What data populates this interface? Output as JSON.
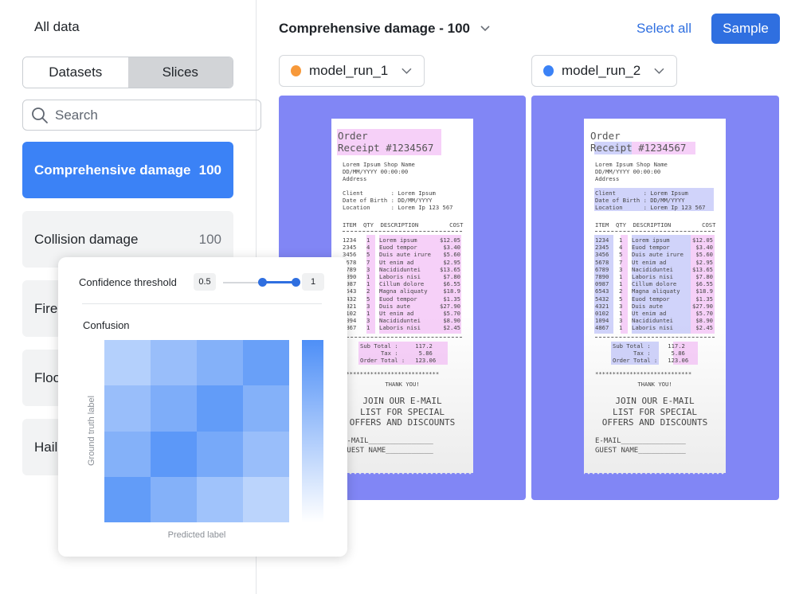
{
  "sidebar": {
    "heading": "All data",
    "tabs": [
      "Datasets",
      "Slices"
    ],
    "active_tab": "Slices",
    "search_placeholder": "Search",
    "slices": [
      {
        "name": "Comprehensive damage",
        "count": "100",
        "selected": true
      },
      {
        "name": "Collision damage",
        "count": "100",
        "selected": false
      },
      {
        "name": "Fire",
        "count": "",
        "selected": false
      },
      {
        "name": "Floo",
        "count": "",
        "selected": false
      },
      {
        "name": "Hail",
        "count": "",
        "selected": false
      }
    ]
  },
  "header": {
    "title": "Comprehensive damage - 100",
    "select_all": "Select all",
    "sample": "Sample"
  },
  "runs": [
    {
      "name": "model_run_1",
      "color": "#f7993a",
      "highlight": "#ec96f0"
    },
    {
      "name": "model_run_2",
      "color": "#3b82f6",
      "highlight": "#aaaff5"
    }
  ],
  "panel_color": "#8186f5",
  "receipt": {
    "order": "Order",
    "receipt_no": "Receipt #1234567",
    "shop": [
      "Lorem Ipsum Shop Name",
      "DD/MM/YYYY 00:00:00",
      "Address"
    ],
    "client_block": [
      "Client        : Lorem Ipsum",
      "Date of Birth : DD/MM/YYYY",
      "Location      : Lorem Ip 123 567"
    ],
    "columns": "ITEM  QTY  DESCRIPTION         COST",
    "items": [
      [
        "1234",
        "1",
        "Lorem ipsum",
        "$12.05"
      ],
      [
        "2345",
        "4",
        "Euod tempor",
        "$3.40"
      ],
      [
        "3456",
        "5",
        "Duis aute irure",
        "$5.60"
      ],
      [
        "5678",
        "7",
        "Ut enim ad",
        "$2.95"
      ],
      [
        "6789",
        "3",
        "Nacididuntei",
        "$13.65"
      ],
      [
        "7890",
        "1",
        "Laboris nisi",
        "$7.80"
      ],
      [
        "0987",
        "1",
        "Cillum dolore",
        "$6.55"
      ],
      [
        "6543",
        "2",
        "Magna aliquaty",
        "$18.9"
      ],
      [
        "5432",
        "5",
        "Euod tempor",
        "$1.35"
      ],
      [
        "4321",
        "3",
        "Duis aute",
        "$27.90"
      ],
      [
        "0102",
        "1",
        "Ut enim ad",
        "$5.70"
      ],
      [
        "1094",
        "3",
        "Nacididuntei",
        "$8.90"
      ],
      [
        "4867",
        "1",
        "Laboris nisi",
        "$2.45"
      ]
    ],
    "totals": [
      "Sub Total :     117.2",
      "      Tax :      5.86",
      "Order Total :   123.06"
    ],
    "stars": "****************************",
    "thanks": "THANK YOU!",
    "join": [
      "JOIN OUR E-MAIL",
      "LIST FOR SPECIAL",
      "OFFERS AND DISCOUNTS"
    ],
    "email": "E-MAIL_______________",
    "guest": "GUEST NAME___________"
  },
  "overlay": {
    "threshold_label": "Confidence threshold",
    "threshold_low": "0.5",
    "threshold_high": "1",
    "threshold_low_value": 0.5,
    "threshold_high_value": 1,
    "confusion_label": "Confusion",
    "y_label": "Ground truth label",
    "x_label": "Predicted label",
    "matrix": [
      [
        0.25,
        0.45,
        0.6,
        0.8
      ],
      [
        0.45,
        0.65,
        0.85,
        0.6
      ],
      [
        0.6,
        0.9,
        0.7,
        0.45
      ],
      [
        0.85,
        0.6,
        0.4,
        0.2
      ]
    ],
    "colorbar_high": "#4e8ff7",
    "colorbar_low": "#ffffff"
  }
}
